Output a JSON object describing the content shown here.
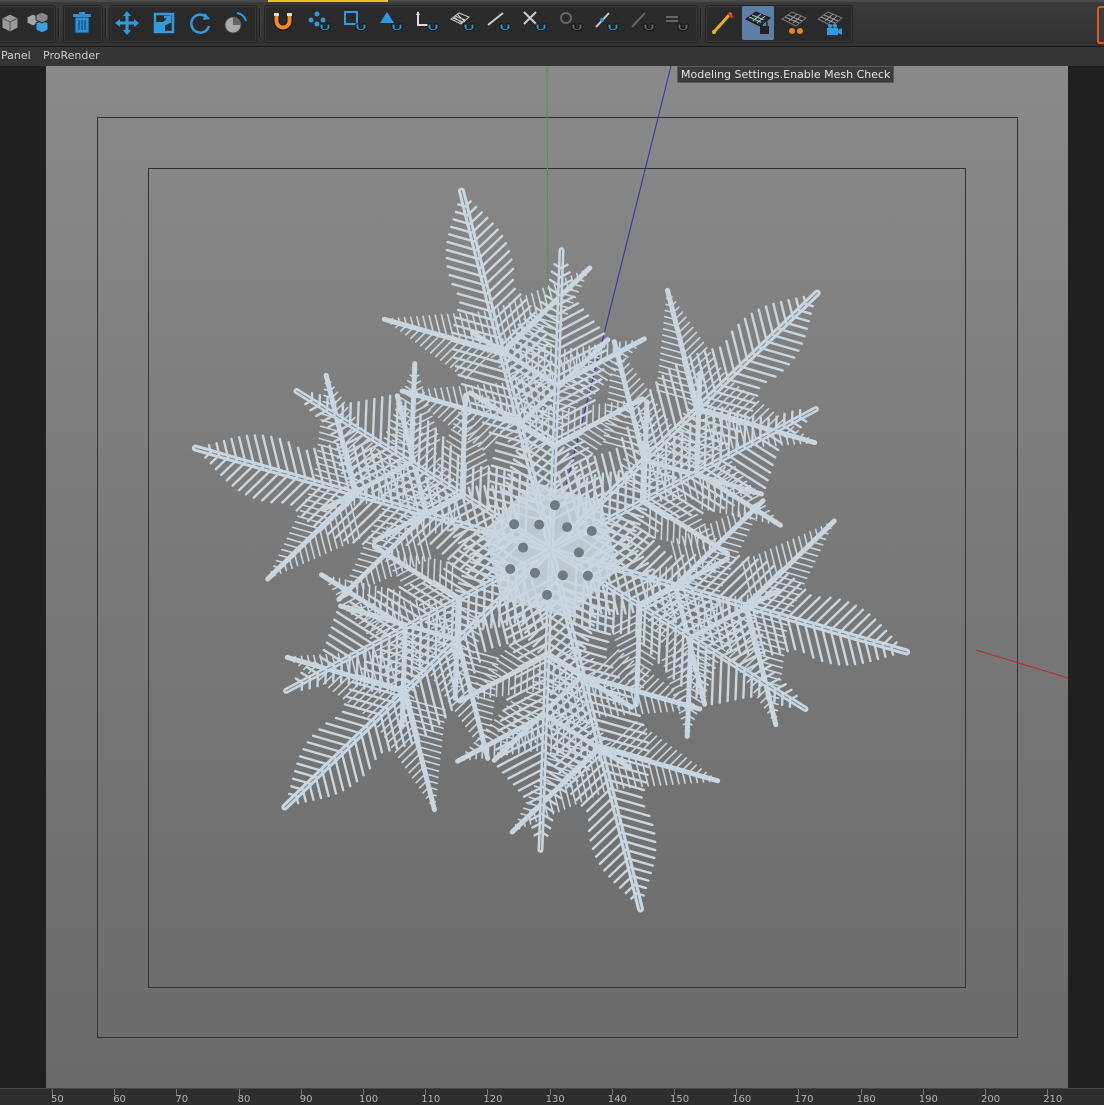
{
  "toolbar": {
    "groups": [
      {
        "id": "g0",
        "buttons": [
          {
            "icon": "cube-icon"
          },
          {
            "icon": "cubes-icon"
          }
        ]
      },
      {
        "id": "g1",
        "buttons": [
          {
            "icon": "trash-icon"
          }
        ]
      },
      {
        "id": "g2",
        "buttons": [
          {
            "icon": "move-icon"
          },
          {
            "icon": "scale-icon"
          },
          {
            "icon": "rotate-icon"
          },
          {
            "icon": "live-selection-icon"
          }
        ]
      },
      {
        "id": "g3",
        "buttons": [
          {
            "icon": "snap-magnet-icon"
          },
          {
            "icon": "snap-points-icon"
          },
          {
            "icon": "snap-box-icon"
          },
          {
            "icon": "snap-triangle-icon"
          },
          {
            "icon": "snap-axis-icon"
          },
          {
            "icon": "snap-grid-icon"
          },
          {
            "icon": "snap-edge-icon"
          },
          {
            "icon": "snap-intersect-icon"
          },
          {
            "icon": "snap-disabled-a-icon"
          },
          {
            "icon": "snap-line-icon"
          },
          {
            "icon": "snap-disabled-b-icon"
          },
          {
            "icon": "snap-disabled-c-icon"
          }
        ]
      },
      {
        "id": "g4",
        "buttons": [
          {
            "icon": "paint-tool-icon"
          },
          {
            "icon": "mesh-check-icon",
            "active": true
          },
          {
            "icon": "mesh-render-icon"
          },
          {
            "icon": "mesh-camera-icon"
          }
        ]
      }
    ]
  },
  "menubar": {
    "items": [
      "Panel",
      "ProRender"
    ]
  },
  "viewport": {
    "tooltip": "Modeling Settings.Enable Mesh Check",
    "background_top": "#8a8a8a",
    "background_bottom": "#6a6a6a",
    "snowflake_color": "#c9d6e0",
    "axis_x_color": "#c0262b",
    "axis_y_color": "#3da33d",
    "axis_z_color": "#2f2fb0"
  },
  "timeline": {
    "labels": [
      "50",
      "60",
      "70",
      "80",
      "90",
      "100",
      "110",
      "120",
      "130",
      "140",
      "150",
      "160",
      "170",
      "180",
      "190",
      "200",
      "210"
    ]
  }
}
